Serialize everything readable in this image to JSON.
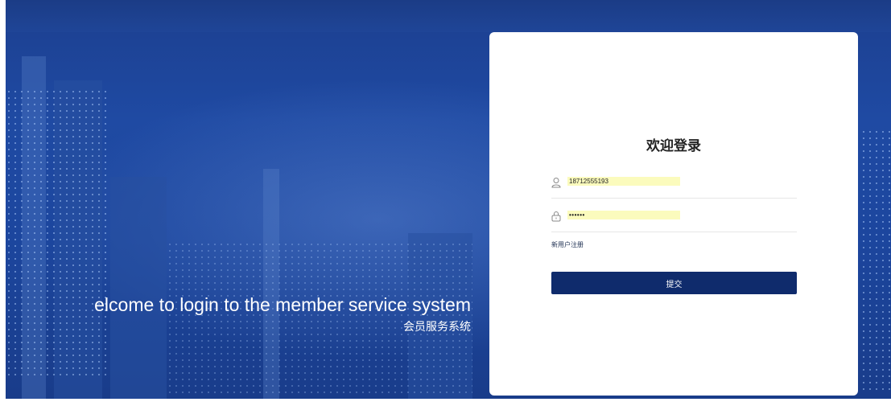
{
  "hero": {
    "welcome_en": "elcome to login to the member service system",
    "welcome_cn": "会员服务系统"
  },
  "login": {
    "title": "欢迎登录",
    "username_value": "18712555193",
    "password_value": "••••••",
    "register_link": "新用户注册",
    "submit_label": "提交"
  },
  "icons": {
    "user": "user-icon",
    "lock": "lock-icon"
  },
  "colors": {
    "background_blue": "#1f4aa3",
    "submit_button": "#0f2b6c",
    "autofill_yellow": "#fbfbbd"
  }
}
